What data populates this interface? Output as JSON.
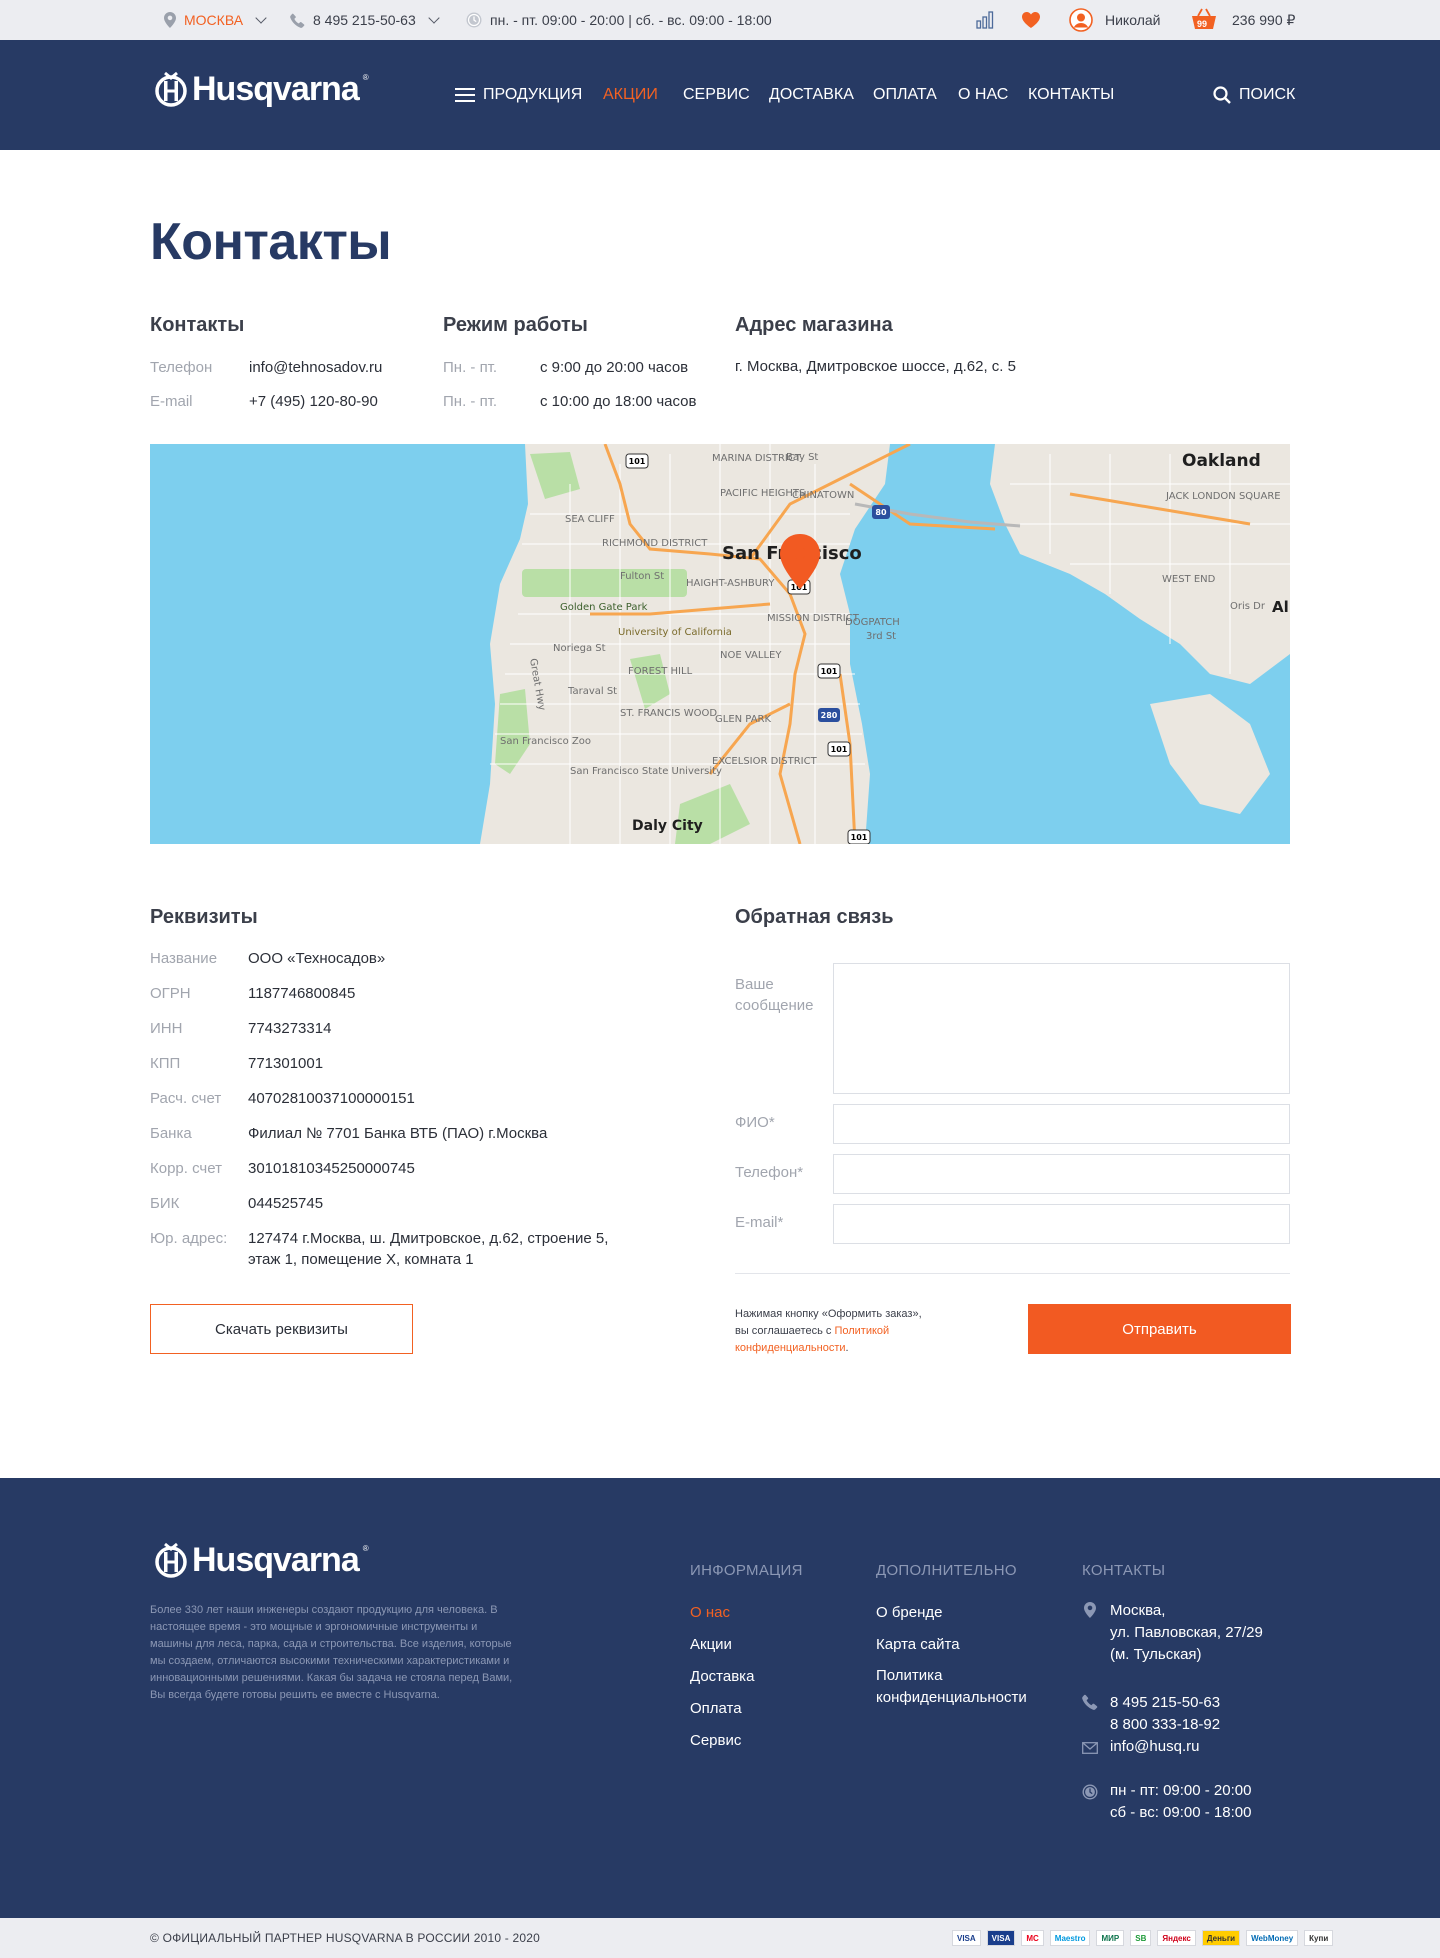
{
  "topbar": {
    "city": "МОСКВА",
    "phone": "8 495 215-50-63",
    "hours": "пн. - пт. 09:00 - 20:00 | сб. - вс. 09:00 - 18:00",
    "user": "Николай",
    "cart_count": "99",
    "cart_total": "236 990 ₽"
  },
  "header": {
    "logo": "Husqvarna",
    "nav": [
      "ПРОДУКЦИЯ",
      "АКЦИИ",
      "СЕРВИС",
      "ДОСТАВКА",
      "ОПЛАТА",
      "О НАС",
      "КОНТАКТЫ"
    ],
    "search": "ПОИСК"
  },
  "page": {
    "title": "Контакты"
  },
  "contacts": {
    "title": "Контакты",
    "phone_label": "Телефон",
    "phone_value": "info@tehnosadov.ru",
    "email_label": "E-mail",
    "email_value": "+7 (495) 120-80-90"
  },
  "hours": {
    "title": "Режим работы",
    "rows": [
      {
        "label": "Пн. - пт.",
        "value": "с 9:00 до 20:00 часов"
      },
      {
        "label": "Пн. - пт.",
        "value": "с 10:00 до 18:00 часов"
      }
    ]
  },
  "address": {
    "title": "Адрес магазина",
    "value": "г. Москва, Дмитровское шоссе, д.62, с. 5"
  },
  "map": {
    "labels": {
      "marina": "MARINA DISTRICT",
      "bay": "Bay St",
      "chinatown": "CHINATOWN",
      "pacific": "PACIFIC HEIGHTS",
      "seacliff": "SEA CLIFF",
      "richmond": "RICHMOND DISTRICT",
      "sf": "San Francisco",
      "fulton": "Fulton St",
      "haight": "HAIGHT-ASHBURY",
      "ggpark": "Golden Gate Park",
      "mission": "MISSION DISTRICT",
      "dogpatch": "DOGPATCH",
      "ucal": "University of California",
      "noriega": "Noriega St",
      "forest": "FOREST HILL",
      "noe": "NOE VALLEY",
      "greathwy": "Great Hwy",
      "taraval": "Taraval St",
      "stfrancis": "ST. FRANCIS WOOD",
      "glenpark": "GLEN PARK",
      "sfzoo": "San Francisco Zoo",
      "excelsior": "EXCELSIOR DISTRICT",
      "sfstate": "San Francisco State University",
      "daly": "Daly City",
      "oakland": "Oakland",
      "jacklondon": "JACK LONDON SQUARE",
      "westend": "WEST END",
      "oris": "Oris Dr",
      "al": "Al",
      "third": "3rd St",
      "hwy101": "101",
      "hwy80": "80",
      "hwy280": "280"
    }
  },
  "requisites": {
    "title": "Реквизиты",
    "rows": [
      {
        "label": "Название",
        "value": "ООО «Техносадов»"
      },
      {
        "label": "ОГРН",
        "value": "1187746800845"
      },
      {
        "label": "ИНН",
        "value": "7743273314"
      },
      {
        "label": "КПП",
        "value": "771301001"
      },
      {
        "label": "Расч. счет",
        "value": "40702810037100000151"
      },
      {
        "label": "Банка",
        "value": "Филиал № 7701 Банка ВТБ (ПАО) г.Москва"
      },
      {
        "label": "Корр. счет",
        "value": "30101810345250000745"
      },
      {
        "label": "БИК",
        "value": "044525745"
      },
      {
        "label": "Юр. адрес:",
        "value_line1": "127474 г.Москва, ш. Дмитровское, д.62, строение 5,",
        "value_line2": "этаж 1, помещение X, комната 1"
      }
    ],
    "download": "Скачать реквизиты"
  },
  "feedback": {
    "title": "Обратная связь",
    "message_label_1": "Ваше",
    "message_label_2": "сообщение",
    "name_label": "ФИО*",
    "phone_label": "Телефон*",
    "email_label": "E-mail*",
    "note_1": "Нажимая кнопку «Оформить заказ»,",
    "note_2": "вы соглашаетесь с ",
    "note_link_1": "Политикой",
    "note_link_2": "конфиденциальности",
    "note_end": ".",
    "submit": "Отправить"
  },
  "footer": {
    "logo": "Husqvarna",
    "description": "Более 330 лет наши инженеры создают продукцию для человека. В настоящее время - это мощные и эргономичные инструменты и машины для леса, парка, сада и строительства. Все изделия, которые мы создаем, отличаются высокими техническими характеристиками и инновационными решениями. Какая бы задача не стояла перед Вами, Вы всегда будете готовы решить ее вместе с Husqvarna.",
    "info_title": "ИНФОРМАЦИЯ",
    "info_links": [
      "О нас",
      "Акции",
      "Доставка",
      "Оплата",
      "Сервис"
    ],
    "extra_title": "ДОПОЛНИТЕЛЬНО",
    "extra_links": [
      "О бренде",
      "Карта сайта"
    ],
    "extra_policy_1": "Политика",
    "extra_policy_2": "конфиденциальности",
    "contacts_title": "КОНТАКТЫ",
    "address_1": "Москва,",
    "address_2": "ул. Павловская, 27/29",
    "address_3": "(м. Тульская)",
    "phone_1": "8 495 215-50-63",
    "phone_2": "8 800 333-18-92",
    "email": "info@husq.ru",
    "hours_1": "пн - пт: 09:00 - 20:00",
    "hours_2": "сб - вс: 09:00 - 18:00"
  },
  "bottom": {
    "copyright": "© ОФИЦИАЛЬНЫЙ ПАРТНЕР HUSQVARNA В РОССИИ 2010 - 2020",
    "payments": [
      "VISA",
      "VISA",
      "MC",
      "Maestro",
      "МИР",
      "SB",
      "Яндекс",
      "Деньги",
      "WebMoney",
      "Купи"
    ]
  },
  "colors": {
    "accent": "#f26122",
    "navy": "#273a64",
    "topbar_bg": "#ecedf1"
  }
}
